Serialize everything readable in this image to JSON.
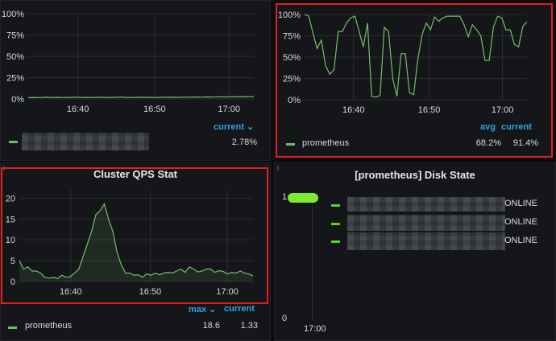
{
  "panels": {
    "top_left": {
      "title": "",
      "legend_header_current": "current ⌄",
      "legend_value_current": "2.78%",
      "chart_data": {
        "type": "line",
        "x_ticks": [
          "16:40",
          "16:50",
          "17:00"
        ],
        "y_ticks": [
          "100%",
          "75%",
          "50%",
          "25%",
          "0%"
        ],
        "ylim": [
          0,
          100
        ],
        "series": [
          {
            "values": [
              1.5,
              1.8,
              1.6,
              2.0,
              1.7,
              1.9,
              1.6,
              1.8,
              2.1,
              1.7,
              1.9,
              1.6,
              1.8,
              2.0,
              1.7,
              1.9,
              2.2,
              1.8,
              1.6,
              1.9,
              2.0,
              1.8,
              1.7,
              2.1,
              1.9,
              2.0,
              1.8,
              2.2,
              2.0,
              2.3,
              2.1,
              2.4,
              2.2,
              2.5,
              2.3,
              2.6,
              2.4,
              2.7,
              2.5,
              2.78
            ]
          }
        ]
      }
    },
    "top_right": {
      "title": "",
      "legend_header_avg": "avg",
      "legend_header_current": "current",
      "legend_series": "prometheus",
      "legend_avg": "68.2%",
      "legend_current": "91.4%",
      "chart_data": {
        "type": "line",
        "x_ticks": [
          "16:40",
          "16:50",
          "17:00"
        ],
        "y_ticks": [
          "100%",
          "75%",
          "50%",
          "25%",
          "0%"
        ],
        "ylim": [
          0,
          100
        ],
        "series": [
          {
            "name": "prometheus",
            "values": [
              100,
              98,
              78,
              60,
              70,
              40,
              30,
              35,
              80,
              80,
              90,
              96,
              98,
              80,
              62,
              90,
              4,
              3,
              5,
              85,
              80,
              25,
              4,
              54,
              54,
              8,
              6,
              48,
              76,
              90,
              82,
              97,
              92,
              96,
              98,
              98,
              98,
              98,
              88,
              74,
              88,
              82,
              75,
              46,
              46,
              85,
              98,
              96,
              82,
              82,
              65,
              62,
              86,
              91.4
            ]
          }
        ]
      }
    },
    "bottom_left": {
      "title": "Cluster QPS Stat",
      "legend_header_max": "max ⌄",
      "legend_header_current": "current",
      "legend_series": "prometheus",
      "legend_max": "18.6",
      "legend_current": "1.33",
      "chart_data": {
        "type": "area",
        "x_ticks": [
          "16:40",
          "16:50",
          "17:00"
        ],
        "y_ticks": [
          "20",
          "15",
          "10",
          "5",
          "0"
        ],
        "ylim": [
          0,
          22
        ],
        "series": [
          {
            "name": "prometheus",
            "values": [
              5,
              3,
              3.5,
              2.5,
              2.5,
              2,
              1,
              0.8,
              1,
              0.7,
              1.5,
              1,
              1.2,
              2,
              3,
              6,
              9,
              12,
              16,
              17,
              18.6,
              15,
              12,
              7,
              4,
              2,
              2,
              1.5,
              1.6,
              1,
              1.8,
              1.5,
              2,
              1.6,
              2,
              2.2,
              2,
              2.5,
              3,
              2.2,
              3.5,
              3,
              2.3,
              2.5,
              3,
              3,
              2.2,
              2.6,
              2.4,
              1.8,
              2.2,
              2,
              2.5,
              2,
              1.8,
              1.33
            ]
          }
        ]
      }
    },
    "bottom_right": {
      "title": "[prometheus] Disk State",
      "y_ticks": [
        "1",
        "0"
      ],
      "x_tick": "17:00",
      "rows": [
        {
          "suffix": "ONLINE"
        },
        {
          "suffix": "ONLINE"
        },
        {
          "suffix": "ONLINE"
        }
      ]
    }
  },
  "colors": {
    "series": "#73bf69",
    "accent": "#33a2e5",
    "highlight": "#e02020",
    "grid": "#2c2e33"
  }
}
